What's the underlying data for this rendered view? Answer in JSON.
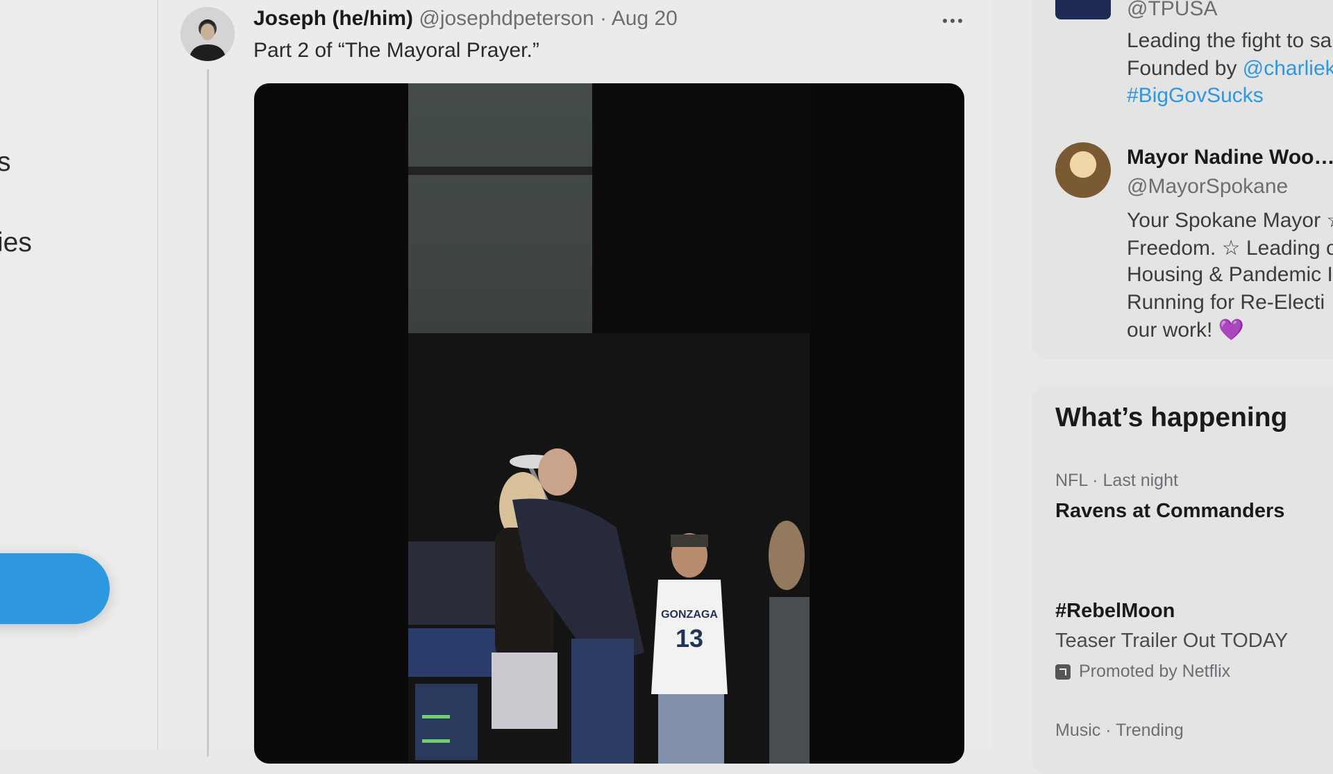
{
  "left_nav": {
    "items": [
      {
        "label_fragment": "s"
      },
      {
        "label_fragment": "ies"
      }
    ]
  },
  "tweet": {
    "author_name": "Joseph (he/him)",
    "author_handle": "@josephdpeterson",
    "separator": "·",
    "date": "Aug 20",
    "text": "Part 2 of “The Mayoral Prayer.”",
    "more_icon": "more-horizontal-icon",
    "video": {
      "jersey_text": "GONZAGA",
      "jersey_number": "13"
    }
  },
  "sidebar": {
    "who_to_follow": [
      {
        "handle": "@TPUSA",
        "bio_lines": [
          "Leading the fight to sa",
          "Founded by "
        ],
        "bio_link": "@charliek",
        "hashtag": "#BigGovSucks"
      },
      {
        "name": "Mayor Nadine Woo…",
        "handle": "@MayorSpokane",
        "bio_lines": [
          "Your Spokane Mayor ☆",
          "Freedom. ☆ Leading o",
          "Housing & Pandemic I",
          "Running for Re-Electi",
          "our work! 💜"
        ]
      }
    ],
    "whats_happening": {
      "title": "What’s happening",
      "trends": [
        {
          "meta": "NFL · Last night",
          "title": "Ravens at Commanders"
        },
        {
          "title": "#RebelMoon",
          "subtitle": "Teaser Trailer Out TODAY",
          "promoted": "Promoted by Netflix"
        },
        {
          "meta": "Music · Trending"
        }
      ]
    }
  },
  "colors": {
    "accent_blue": "#2d97e0",
    "background": "#e9e9e9"
  }
}
